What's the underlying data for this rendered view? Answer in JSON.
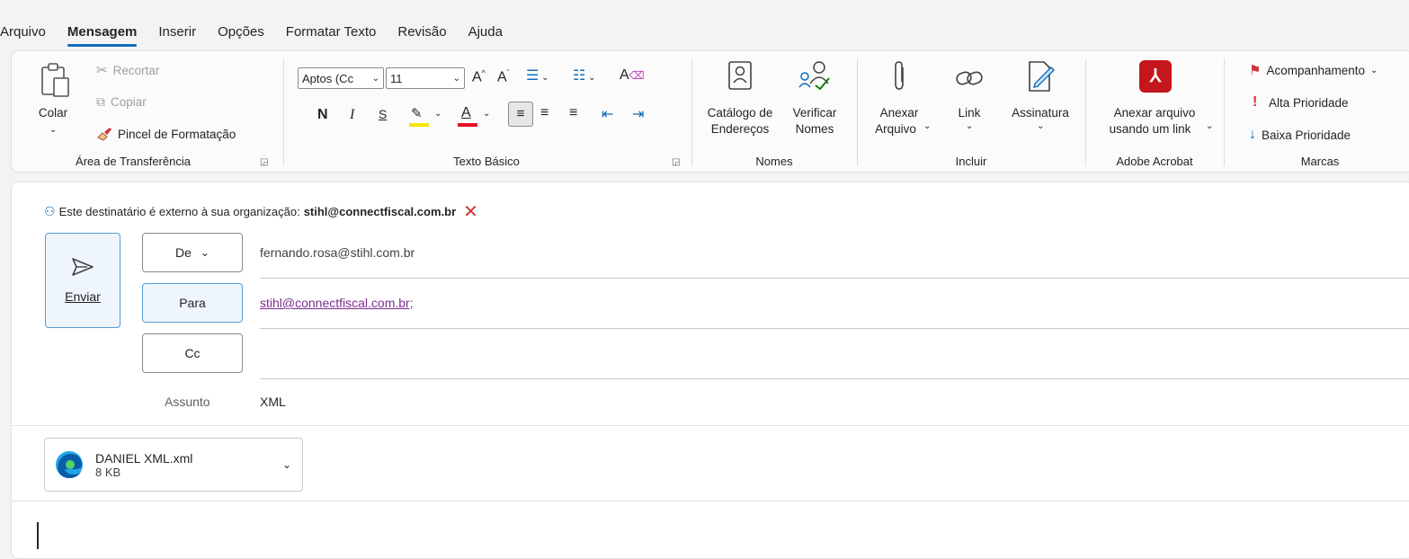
{
  "menu": {
    "tabs": [
      "Arquivo",
      "Mensagem",
      "Inserir",
      "Opções",
      "Formatar Texto",
      "Revisão",
      "Ajuda"
    ],
    "active_tab": "Mensagem"
  },
  "ribbon": {
    "clipboard": {
      "paste": "Colar",
      "cut": "Recortar",
      "copy": "Copiar",
      "format_painter": "Pincel de Formatação",
      "label": "Área de Transferência"
    },
    "basic_text": {
      "font_name": "Aptos (Cc",
      "font_size": "11",
      "bold": "N",
      "italic": "I",
      "underline": "S",
      "font_color_glyph": "A",
      "label": "Texto Básico",
      "highlight_color": "#f2e600",
      "font_color": "#e81123"
    },
    "names": {
      "address_book_line1": "Catálogo de",
      "address_book_line2": "Endereços",
      "check_names_line1": "Verificar",
      "check_names_line2": "Nomes",
      "label": "Nomes"
    },
    "include": {
      "attach_line1": "Anexar",
      "attach_line2": "Arquivo",
      "link": "Link",
      "signature": "Assinatura",
      "label": "Incluir"
    },
    "adobe": {
      "attach_link_line1": "Anexar arquivo",
      "attach_link_line2": "usando um link",
      "label": "Adobe Acrobat",
      "brand_color": "#c4161c"
    },
    "tags": {
      "follow_up": "Acompanhamento",
      "high_priority": "Alta Prioridade",
      "low_priority": "Baixa Prioridade",
      "label": "Marcas"
    }
  },
  "compose": {
    "notice_text": "Este destinatário é externo à sua organização:",
    "notice_address": "stihl@connectfiscal.com.br",
    "send": "Enviar",
    "from_label": "De",
    "from_value": "fernando.rosa@stihl.com.br",
    "to_label": "Para",
    "to_value": "stihl@connectfiscal.com.br;",
    "cc_label": "Cc",
    "subject_label": "Assunto",
    "subject_value": "XML",
    "attachment": {
      "name": "DANIEL XML.xml",
      "size": "8 KB"
    }
  }
}
